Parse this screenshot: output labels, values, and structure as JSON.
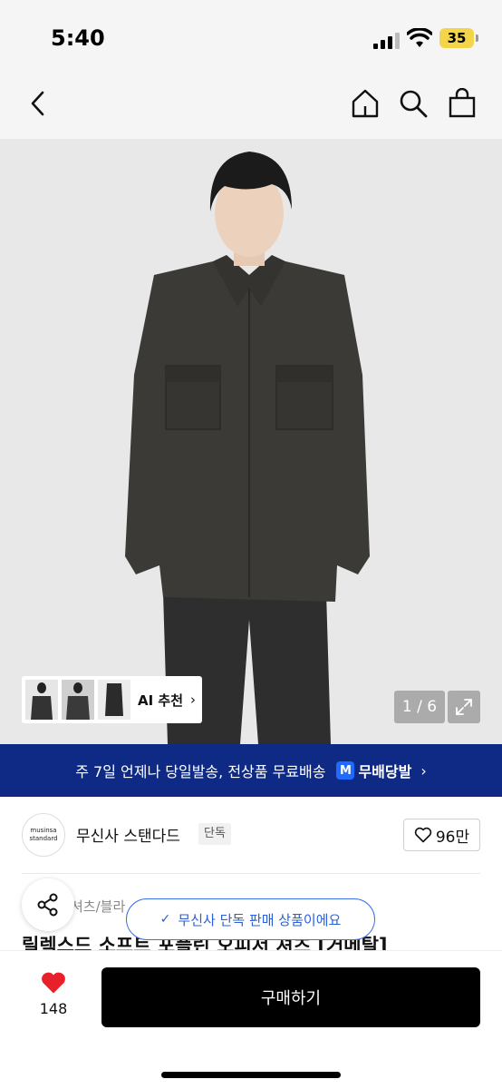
{
  "status_bar": {
    "time": "5:40",
    "battery": "35"
  },
  "nav": {
    "back_icon": "chevron-left-icon",
    "home_icon": "home-icon",
    "search_icon": "search-icon",
    "cart_icon": "shopping-bag-icon"
  },
  "gallery": {
    "ai_recommend_label": "AI 추천",
    "page_counter": "1 / 6",
    "thumbnails": [
      "thumb-1",
      "thumb-2",
      "thumb-3"
    ]
  },
  "shipping_banner": {
    "text": "주 7일 언제나 당일발송, 전상품 무료배송",
    "badge": "M",
    "brand": "무배당발"
  },
  "brand": {
    "logo_line1": "musinsa",
    "logo_line2": "standard",
    "name": "무신사 스탠다드",
    "tag": "단독",
    "likes": "96만"
  },
  "product": {
    "category": "셔츠/블라",
    "title": "릴렉스드 소프트 포플린 오피서 셔츠 [거메탈]",
    "exclusive_notice": "무신사 단독 판매 상품이에요"
  },
  "bottom_bar": {
    "wishlist_count": "148",
    "buy_label": "구매하기"
  },
  "colors": {
    "banner_bg": "#0e2a85",
    "accent_blue": "#2a5fd8",
    "heart_red": "#e8202a",
    "buy_bg": "#000000"
  }
}
